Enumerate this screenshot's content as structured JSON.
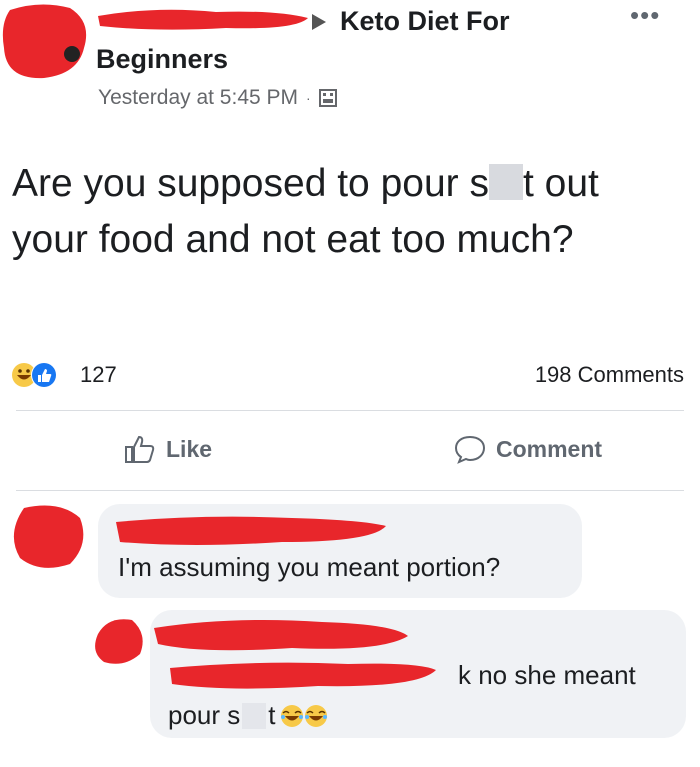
{
  "post": {
    "group_line1": "Keto Diet For",
    "group_line2": "Beginners",
    "timestamp": "Yesterday at 5:45 PM",
    "separator": "·",
    "text_before_censor": "Are you supposed to pour s",
    "text_after_censor": "t out your food and not eat too much?",
    "reaction_count": "127",
    "comment_count": "198 Comments"
  },
  "actions": {
    "like_label": "Like",
    "comment_label": "Comment"
  },
  "comments": [
    {
      "text": "I'm assuming you meant portion?"
    },
    {
      "text_line1": "k  no she meant",
      "text_line2_a": "pour s",
      "text_line2_b": "t"
    }
  ],
  "colors": {
    "redaction": "#e8262b",
    "secondary_text": "#65676b",
    "bubble": "#f0f2f5",
    "like_blue": "#1877f2",
    "emoji_yellow": "#f7c948"
  },
  "icons": [
    "more-icon",
    "globe-icon",
    "haha-reaction-icon",
    "like-reaction-icon",
    "like-icon",
    "comment-icon",
    "laughing-emoji-icon"
  ]
}
